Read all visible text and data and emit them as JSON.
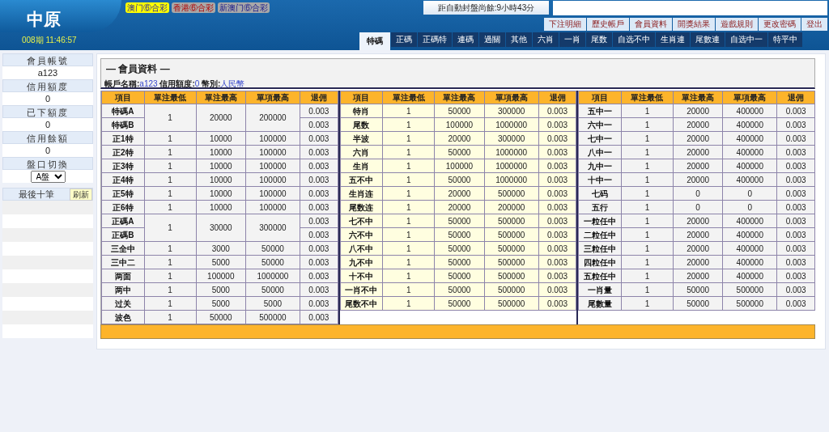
{
  "header": {
    "logo": "中原",
    "period_time": "008期 11:46:57",
    "countdown": "距自動封盤尚餘:9小時43分",
    "lottery_tabs": [
      {
        "label": "澳门⑥合彩",
        "selected": true
      },
      {
        "label": "香港⑥合彩",
        "selected": false
      },
      {
        "label": "新澳门⑥合彩",
        "selected": false
      }
    ]
  },
  "top_links": [
    "下注明細",
    "歷史帳戶",
    "會員資料",
    "開獎結果",
    "遊戲規則",
    "更改密碼",
    "登出"
  ],
  "game_tabs": [
    {
      "label": "特碼",
      "selected": true
    },
    {
      "label": "正碼",
      "selected": false
    },
    {
      "label": "正碼特",
      "selected": false
    },
    {
      "label": "連碼",
      "selected": false
    },
    {
      "label": "過關",
      "selected": false
    },
    {
      "label": "其他",
      "selected": false
    },
    {
      "label": "六肖",
      "selected": false
    },
    {
      "label": "一肖",
      "selected": false
    },
    {
      "label": "尾数",
      "selected": false
    },
    {
      "label": "自选不中",
      "selected": false
    },
    {
      "label": "生肖連",
      "selected": false
    },
    {
      "label": "尾數連",
      "selected": false
    },
    {
      "label": "自选中一",
      "selected": false
    },
    {
      "label": "特平中",
      "selected": false
    }
  ],
  "sidebar": {
    "fields": [
      {
        "label": "會員帳號",
        "kind": "text",
        "value": "a123"
      },
      {
        "label": "信用額度",
        "kind": "text",
        "value": "0"
      },
      {
        "label": "已下額度",
        "kind": "text",
        "value": "0"
      },
      {
        "label": "信用餘額",
        "kind": "text",
        "value": "0"
      },
      {
        "label": "盤口切換",
        "kind": "select",
        "value": "A盤"
      }
    ],
    "recent": {
      "title": "最後十筆",
      "refresh": "刷新"
    }
  },
  "panel": {
    "title": "— 會員資料 —",
    "account_label": "帳戶名稱:",
    "account": "a123",
    "credit_label": "信用額度:",
    "credit": "0",
    "currency_label": "幣別:",
    "currency": "人民幣"
  },
  "tables": [
    {
      "columns": [
        "項目",
        "單注最低",
        "單注最高",
        "單項最高",
        "退佣"
      ],
      "rows": [
        {
          "items": [
            {
              "name": "特碼A",
              "rebate": "0.003"
            },
            {
              "name": "特碼B",
              "rebate": "0.003"
            }
          ],
          "min": "1",
          "max": "20000",
          "item_max": "200000"
        },
        {
          "items": [
            {
              "name": "正1特",
              "rebate": "0.003"
            }
          ],
          "min": "1",
          "max": "10000",
          "item_max": "100000"
        },
        {
          "items": [
            {
              "name": "正2特",
              "rebate": "0.003"
            }
          ],
          "min": "1",
          "max": "10000",
          "item_max": "100000"
        },
        {
          "items": [
            {
              "name": "正3特",
              "rebate": "0.003"
            }
          ],
          "min": "1",
          "max": "10000",
          "item_max": "100000"
        },
        {
          "items": [
            {
              "name": "正4特",
              "rebate": "0.003"
            }
          ],
          "min": "1",
          "max": "10000",
          "item_max": "100000"
        },
        {
          "items": [
            {
              "name": "正5特",
              "rebate": "0.003"
            }
          ],
          "min": "1",
          "max": "10000",
          "item_max": "100000"
        },
        {
          "items": [
            {
              "name": "正6特",
              "rebate": "0.003"
            }
          ],
          "min": "1",
          "max": "10000",
          "item_max": "100000"
        },
        {
          "items": [
            {
              "name": "正碼A",
              "rebate": "0.003"
            },
            {
              "name": "正碼B",
              "rebate": "0.003"
            }
          ],
          "min": "1",
          "max": "30000",
          "item_max": "300000"
        },
        {
          "items": [
            {
              "name": "三全中",
              "rebate": "0.003"
            }
          ],
          "min": "1",
          "max": "3000",
          "item_max": "50000"
        },
        {
          "items": [
            {
              "name": "三中二",
              "rebate": "0.003"
            }
          ],
          "min": "1",
          "max": "5000",
          "item_max": "50000"
        },
        {
          "items": [
            {
              "name": "两面",
              "rebate": "0.003"
            }
          ],
          "min": "1",
          "max": "100000",
          "item_max": "1000000"
        },
        {
          "items": [
            {
              "name": "两中",
              "rebate": "0.003"
            }
          ],
          "min": "1",
          "max": "5000",
          "item_max": "50000"
        },
        {
          "items": [
            {
              "name": "过关",
              "rebate": "0.003"
            }
          ],
          "min": "1",
          "max": "5000",
          "item_max": "5000"
        },
        {
          "items": [
            {
              "name": "波色",
              "rebate": "0.003"
            }
          ],
          "min": "1",
          "max": "50000",
          "item_max": "500000"
        }
      ]
    },
    {
      "columns": [
        "項目",
        "單注最低",
        "單注最高",
        "單項最高",
        "退佣"
      ],
      "rows": [
        {
          "items": [
            {
              "name": "特肖",
              "rebate": "0.003"
            }
          ],
          "min": "1",
          "max": "50000",
          "item_max": "300000"
        },
        {
          "items": [
            {
              "name": "尾数",
              "rebate": "0.003"
            }
          ],
          "min": "1",
          "max": "100000",
          "item_max": "1000000"
        },
        {
          "items": [
            {
              "name": "半波",
              "rebate": "0.003"
            }
          ],
          "min": "1",
          "max": "20000",
          "item_max": "300000"
        },
        {
          "items": [
            {
              "name": "六肖",
              "rebate": "0.003"
            }
          ],
          "min": "1",
          "max": "50000",
          "item_max": "1000000"
        },
        {
          "items": [
            {
              "name": "生肖",
              "rebate": "0.003"
            }
          ],
          "min": "1",
          "max": "100000",
          "item_max": "1000000"
        },
        {
          "items": [
            {
              "name": "五不中",
              "rebate": "0.003"
            }
          ],
          "min": "1",
          "max": "50000",
          "item_max": "1000000"
        },
        {
          "items": [
            {
              "name": "生肖连",
              "rebate": "0.003"
            }
          ],
          "min": "1",
          "max": "20000",
          "item_max": "500000"
        },
        {
          "items": [
            {
              "name": "尾数连",
              "rebate": "0.003"
            }
          ],
          "min": "1",
          "max": "20000",
          "item_max": "200000"
        },
        {
          "items": [
            {
              "name": "七不中",
              "rebate": "0.003"
            }
          ],
          "min": "1",
          "max": "50000",
          "item_max": "500000"
        },
        {
          "items": [
            {
              "name": "六不中",
              "rebate": "0.003"
            }
          ],
          "min": "1",
          "max": "50000",
          "item_max": "500000"
        },
        {
          "items": [
            {
              "name": "八不中",
              "rebate": "0.003"
            }
          ],
          "min": "1",
          "max": "50000",
          "item_max": "500000"
        },
        {
          "items": [
            {
              "name": "九不中",
              "rebate": "0.003"
            }
          ],
          "min": "1",
          "max": "50000",
          "item_max": "500000"
        },
        {
          "items": [
            {
              "name": "十不中",
              "rebate": "0.003"
            }
          ],
          "min": "1",
          "max": "50000",
          "item_max": "500000"
        },
        {
          "items": [
            {
              "name": "一肖不中",
              "rebate": "0.003"
            }
          ],
          "min": "1",
          "max": "50000",
          "item_max": "500000"
        },
        {
          "items": [
            {
              "name": "尾数不中",
              "rebate": "0.003"
            }
          ],
          "min": "1",
          "max": "50000",
          "item_max": "500000"
        }
      ]
    },
    {
      "columns": [
        "項目",
        "單注最低",
        "單注最高",
        "單項最高",
        "退佣"
      ],
      "rows": [
        {
          "items": [
            {
              "name": "五中一",
              "rebate": "0.003"
            }
          ],
          "min": "1",
          "max": "20000",
          "item_max": "400000"
        },
        {
          "items": [
            {
              "name": "六中一",
              "rebate": "0.003"
            }
          ],
          "min": "1",
          "max": "20000",
          "item_max": "400000"
        },
        {
          "items": [
            {
              "name": "七中一",
              "rebate": "0.003"
            }
          ],
          "min": "1",
          "max": "20000",
          "item_max": "400000"
        },
        {
          "items": [
            {
              "name": "八中一",
              "rebate": "0.003"
            }
          ],
          "min": "1",
          "max": "20000",
          "item_max": "400000"
        },
        {
          "items": [
            {
              "name": "九中一",
              "rebate": "0.003"
            }
          ],
          "min": "1",
          "max": "20000",
          "item_max": "400000"
        },
        {
          "items": [
            {
              "name": "十中一",
              "rebate": "0.003"
            }
          ],
          "min": "1",
          "max": "20000",
          "item_max": "400000"
        },
        {
          "items": [
            {
              "name": "七码",
              "rebate": "0.003"
            }
          ],
          "min": "1",
          "max": "0",
          "item_max": "0"
        },
        {
          "items": [
            {
              "name": "五行",
              "rebate": "0.003"
            }
          ],
          "min": "1",
          "max": "0",
          "item_max": "0"
        },
        {
          "items": [
            {
              "name": "一粒任中",
              "rebate": "0.003"
            }
          ],
          "min": "1",
          "max": "20000",
          "item_max": "400000"
        },
        {
          "items": [
            {
              "name": "二粒任中",
              "rebate": "0.003"
            }
          ],
          "min": "1",
          "max": "20000",
          "item_max": "400000"
        },
        {
          "items": [
            {
              "name": "三粒任中",
              "rebate": "0.003"
            }
          ],
          "min": "1",
          "max": "20000",
          "item_max": "400000"
        },
        {
          "items": [
            {
              "name": "四粒任中",
              "rebate": "0.003"
            }
          ],
          "min": "1",
          "max": "20000",
          "item_max": "400000"
        },
        {
          "items": [
            {
              "name": "五粒任中",
              "rebate": "0.003"
            }
          ],
          "min": "1",
          "max": "20000",
          "item_max": "400000"
        },
        {
          "items": [
            {
              "name": "一肖量",
              "rebate": "0.003"
            }
          ],
          "min": "1",
          "max": "50000",
          "item_max": "500000"
        },
        {
          "items": [
            {
              "name": "尾數量",
              "rebate": "0.003"
            }
          ],
          "min": "1",
          "max": "50000",
          "item_max": "500000"
        }
      ]
    }
  ]
}
